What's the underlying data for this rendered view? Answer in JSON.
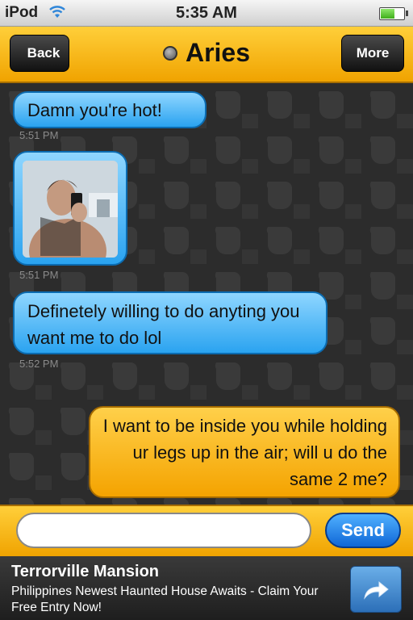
{
  "statusbar": {
    "carrier": "iPod",
    "time": "5:35 AM",
    "wifi_icon": "wifi-icon",
    "battery_icon": "battery-icon"
  },
  "navbar": {
    "back_label": "Back",
    "title": "Aries",
    "more_label": "More",
    "status_icon": "status-dot-icon"
  },
  "messages": [
    {
      "direction": "in",
      "type": "text",
      "text": "Damn you're hot!",
      "time": "5:51 PM"
    },
    {
      "direction": "in",
      "type": "photo",
      "time": "5:51 PM"
    },
    {
      "direction": "in",
      "type": "text",
      "text": "Definetely willing to do anyting you want me to do lol",
      "time": "5:52 PM"
    },
    {
      "direction": "out",
      "type": "text",
      "text": "I want to be inside you while holding ur legs up in the air; will u do the same 2 me?"
    }
  ],
  "composer": {
    "input_value": "",
    "send_label": "Send"
  },
  "ad": {
    "title": "Terrorville Mansion",
    "text": "Philippines Newest Haunted House Awaits - Claim Your Free Entry Now!",
    "icon": "share-arrow-icon"
  },
  "colors": {
    "accent_yellow": "#f0a300",
    "incoming_blue": "#2aa3f0",
    "background": "#2e2e2e"
  }
}
